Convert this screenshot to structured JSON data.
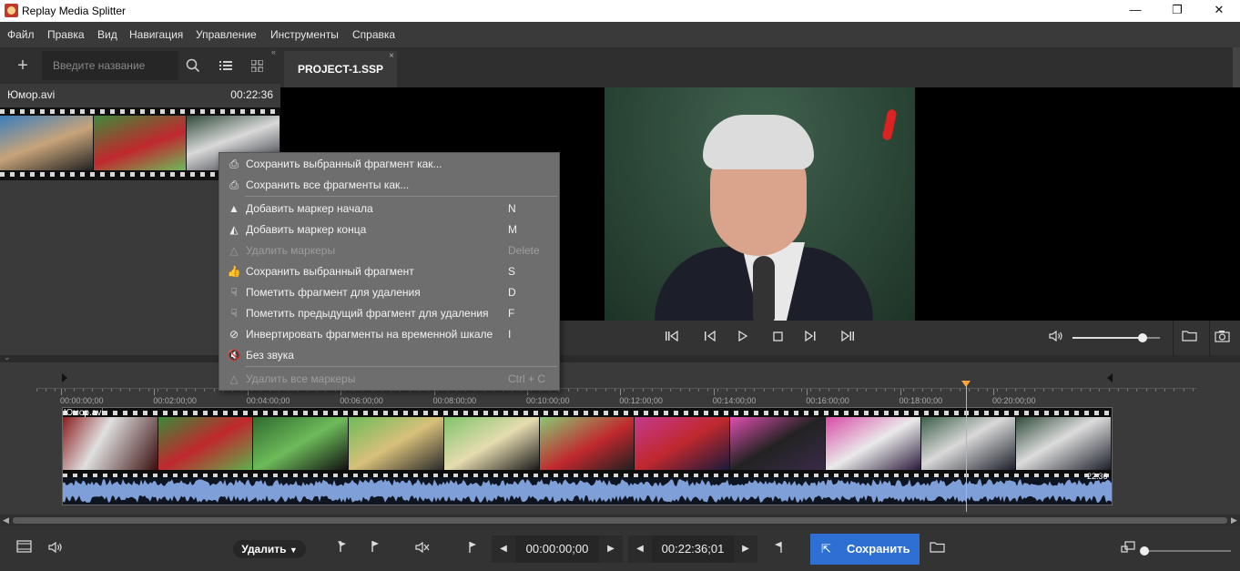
{
  "window": {
    "title": "Replay Media Splitter",
    "minimize": "—",
    "maximize": "❐",
    "close": "✕"
  },
  "menu": [
    "Файл",
    "Правка",
    "Вид",
    "Навигация",
    "Управление",
    "Инструменты",
    "Справка"
  ],
  "library": {
    "search_placeholder": "Введите название",
    "file_name": "Юмор.avi",
    "file_duration": "00:22:36"
  },
  "project_tab": {
    "label": "PROJECT-1.SSP",
    "close": "×"
  },
  "context_menu": {
    "items": [
      {
        "label": "Сохранить выбранный фрагмент как...",
        "key": "",
        "icon": "save-as-icon",
        "disabled": false
      },
      {
        "label": "Сохранить все фрагменты как...",
        "key": "",
        "icon": "save-all-icon",
        "disabled": false
      },
      {
        "label": "Добавить маркер начала",
        "key": "N",
        "icon": "marker-start-icon",
        "disabled": false
      },
      {
        "label": "Добавить маркер конца",
        "key": "M",
        "icon": "marker-end-icon",
        "disabled": false
      },
      {
        "label": "Удалить маркеры",
        "key": "Delete",
        "icon": "remove-markers-icon",
        "disabled": true
      },
      {
        "label": "Сохранить выбранный фрагмент",
        "key": "S",
        "icon": "thumbs-up-icon",
        "disabled": false
      },
      {
        "label": "Пометить фрагмент для удаления",
        "key": "D",
        "icon": "thumbs-down-icon",
        "disabled": false
      },
      {
        "label": "Пометить предыдущий фрагмент для удаления",
        "key": "F",
        "icon": "thumbs-down-prev-icon",
        "disabled": false
      },
      {
        "label": "Инвертировать фрагменты на временной шкале",
        "key": "I",
        "icon": "invert-icon",
        "disabled": false
      },
      {
        "label": "Без звука",
        "key": "",
        "icon": "mute-icon",
        "disabled": false
      },
      {
        "label": "Удалить все маркеры",
        "key": "Ctrl + C",
        "icon": "remove-all-markers-icon",
        "disabled": true
      }
    ]
  },
  "player": {
    "volume_percent": 80
  },
  "timeline": {
    "ticks": [
      "00:00:00;00",
      "00:02:00;00",
      "00:04:00;00",
      "00:06:00;00",
      "00:08:00;00",
      "00:10:00;00",
      "00:12:00;00",
      "00:14:00;00",
      "00:16:00;00",
      "00:18:00;00",
      "00:20:00;00"
    ],
    "track_label": "Юмор.avi",
    "track_duration": "22:36"
  },
  "bottom": {
    "delete_label": "Удалить",
    "start_time": "00:00:00;00",
    "end_time": "00:22:36;01",
    "save_label": "Сохранить"
  },
  "colors": {
    "accent": "#2d6fd3",
    "playhead": "#ffa640",
    "waveform": "#7f9fd8"
  }
}
